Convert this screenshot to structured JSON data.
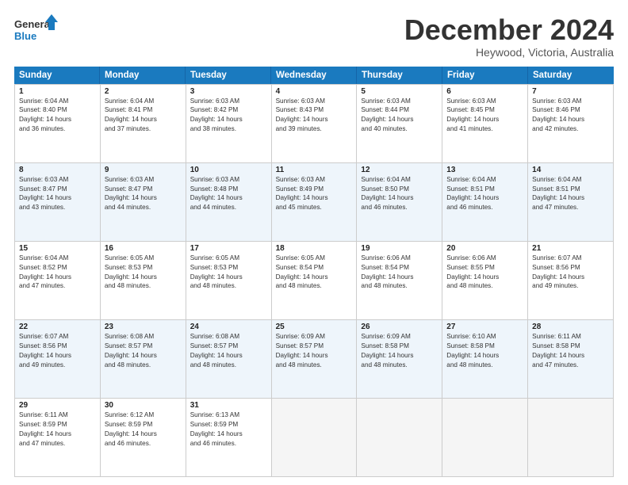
{
  "logo": {
    "line1": "General",
    "line2": "Blue"
  },
  "title": "December 2024",
  "location": "Heywood, Victoria, Australia",
  "days_header": [
    "Sunday",
    "Monday",
    "Tuesday",
    "Wednesday",
    "Thursday",
    "Friday",
    "Saturday"
  ],
  "weeks": [
    [
      {
        "day": "1",
        "info": "Sunrise: 6:04 AM\nSunset: 8:40 PM\nDaylight: 14 hours\nand 36 minutes."
      },
      {
        "day": "2",
        "info": "Sunrise: 6:04 AM\nSunset: 8:41 PM\nDaylight: 14 hours\nand 37 minutes."
      },
      {
        "day": "3",
        "info": "Sunrise: 6:03 AM\nSunset: 8:42 PM\nDaylight: 14 hours\nand 38 minutes."
      },
      {
        "day": "4",
        "info": "Sunrise: 6:03 AM\nSunset: 8:43 PM\nDaylight: 14 hours\nand 39 minutes."
      },
      {
        "day": "5",
        "info": "Sunrise: 6:03 AM\nSunset: 8:44 PM\nDaylight: 14 hours\nand 40 minutes."
      },
      {
        "day": "6",
        "info": "Sunrise: 6:03 AM\nSunset: 8:45 PM\nDaylight: 14 hours\nand 41 minutes."
      },
      {
        "day": "7",
        "info": "Sunrise: 6:03 AM\nSunset: 8:46 PM\nDaylight: 14 hours\nand 42 minutes."
      }
    ],
    [
      {
        "day": "8",
        "info": "Sunrise: 6:03 AM\nSunset: 8:47 PM\nDaylight: 14 hours\nand 43 minutes."
      },
      {
        "day": "9",
        "info": "Sunrise: 6:03 AM\nSunset: 8:47 PM\nDaylight: 14 hours\nand 44 minutes."
      },
      {
        "day": "10",
        "info": "Sunrise: 6:03 AM\nSunset: 8:48 PM\nDaylight: 14 hours\nand 44 minutes."
      },
      {
        "day": "11",
        "info": "Sunrise: 6:03 AM\nSunset: 8:49 PM\nDaylight: 14 hours\nand 45 minutes."
      },
      {
        "day": "12",
        "info": "Sunrise: 6:04 AM\nSunset: 8:50 PM\nDaylight: 14 hours\nand 46 minutes."
      },
      {
        "day": "13",
        "info": "Sunrise: 6:04 AM\nSunset: 8:51 PM\nDaylight: 14 hours\nand 46 minutes."
      },
      {
        "day": "14",
        "info": "Sunrise: 6:04 AM\nSunset: 8:51 PM\nDaylight: 14 hours\nand 47 minutes."
      }
    ],
    [
      {
        "day": "15",
        "info": "Sunrise: 6:04 AM\nSunset: 8:52 PM\nDaylight: 14 hours\nand 47 minutes."
      },
      {
        "day": "16",
        "info": "Sunrise: 6:05 AM\nSunset: 8:53 PM\nDaylight: 14 hours\nand 48 minutes."
      },
      {
        "day": "17",
        "info": "Sunrise: 6:05 AM\nSunset: 8:53 PM\nDaylight: 14 hours\nand 48 minutes."
      },
      {
        "day": "18",
        "info": "Sunrise: 6:05 AM\nSunset: 8:54 PM\nDaylight: 14 hours\nand 48 minutes."
      },
      {
        "day": "19",
        "info": "Sunrise: 6:06 AM\nSunset: 8:54 PM\nDaylight: 14 hours\nand 48 minutes."
      },
      {
        "day": "20",
        "info": "Sunrise: 6:06 AM\nSunset: 8:55 PM\nDaylight: 14 hours\nand 48 minutes."
      },
      {
        "day": "21",
        "info": "Sunrise: 6:07 AM\nSunset: 8:56 PM\nDaylight: 14 hours\nand 49 minutes."
      }
    ],
    [
      {
        "day": "22",
        "info": "Sunrise: 6:07 AM\nSunset: 8:56 PM\nDaylight: 14 hours\nand 49 minutes."
      },
      {
        "day": "23",
        "info": "Sunrise: 6:08 AM\nSunset: 8:57 PM\nDaylight: 14 hours\nand 48 minutes."
      },
      {
        "day": "24",
        "info": "Sunrise: 6:08 AM\nSunset: 8:57 PM\nDaylight: 14 hours\nand 48 minutes."
      },
      {
        "day": "25",
        "info": "Sunrise: 6:09 AM\nSunset: 8:57 PM\nDaylight: 14 hours\nand 48 minutes."
      },
      {
        "day": "26",
        "info": "Sunrise: 6:09 AM\nSunset: 8:58 PM\nDaylight: 14 hours\nand 48 minutes."
      },
      {
        "day": "27",
        "info": "Sunrise: 6:10 AM\nSunset: 8:58 PM\nDaylight: 14 hours\nand 48 minutes."
      },
      {
        "day": "28",
        "info": "Sunrise: 6:11 AM\nSunset: 8:58 PM\nDaylight: 14 hours\nand 47 minutes."
      }
    ],
    [
      {
        "day": "29",
        "info": "Sunrise: 6:11 AM\nSunset: 8:59 PM\nDaylight: 14 hours\nand 47 minutes."
      },
      {
        "day": "30",
        "info": "Sunrise: 6:12 AM\nSunset: 8:59 PM\nDaylight: 14 hours\nand 46 minutes."
      },
      {
        "day": "31",
        "info": "Sunrise: 6:13 AM\nSunset: 8:59 PM\nDaylight: 14 hours\nand 46 minutes."
      },
      {
        "day": "",
        "info": ""
      },
      {
        "day": "",
        "info": ""
      },
      {
        "day": "",
        "info": ""
      },
      {
        "day": "",
        "info": ""
      }
    ]
  ],
  "alt_rows": [
    1,
    3
  ]
}
